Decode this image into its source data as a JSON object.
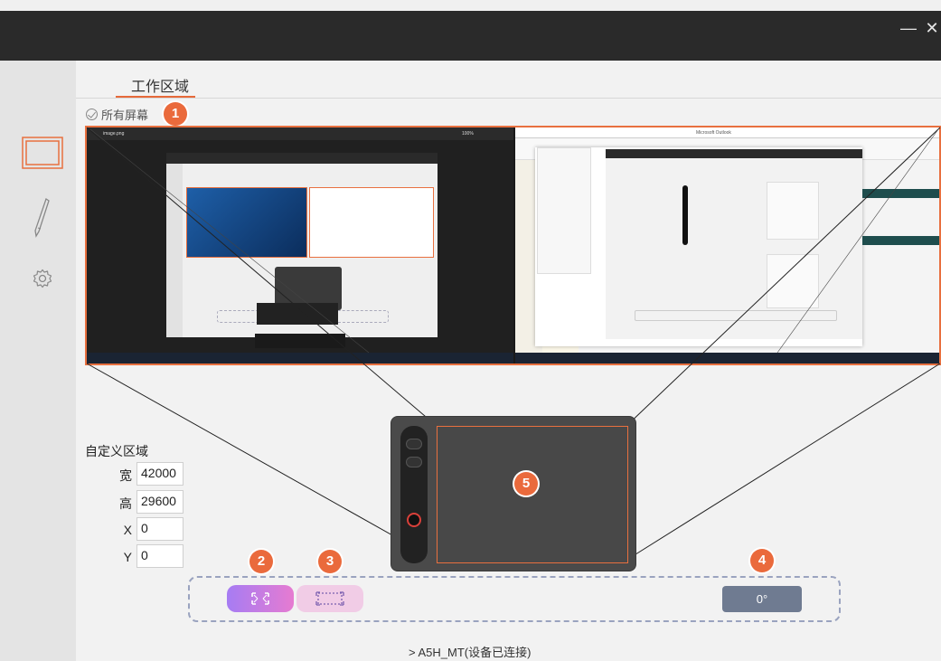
{
  "window": {
    "minimize_glyph": "—",
    "close_glyph": "✕"
  },
  "sidebar": {
    "items": [
      {
        "name": "screen-area",
        "icon": "display-icon",
        "active": true
      },
      {
        "name": "pen",
        "icon": "pen-icon",
        "active": false
      },
      {
        "name": "settings",
        "icon": "gear-icon",
        "active": false
      }
    ]
  },
  "tabs": {
    "work_area": "工作区域"
  },
  "screen_option": {
    "label": "所有屏幕"
  },
  "badges": {
    "b1": "1",
    "b2": "2",
    "b3": "3",
    "b4": "4",
    "b5": "5"
  },
  "screens_preview": {
    "screen1_title": "image.png",
    "screen1_zoom": "100%",
    "screen2_title": "Microsoft Outlook"
  },
  "custom_area": {
    "title": "自定义区域",
    "width_label": "宽",
    "width_value": "42000",
    "height_label": "高",
    "height_value": "29600",
    "x_label": "X",
    "x_value": "0",
    "y_label": "Y",
    "y_value": "0"
  },
  "actions": {
    "rotate_label": "0°"
  },
  "device": {
    "status": "A5H_MT(设备已连接)",
    "chevron": ">"
  },
  "colors": {
    "accent": "#ea6a3c",
    "titlebar": "#2a2a2a",
    "rotate_button": "#6f7b91"
  }
}
